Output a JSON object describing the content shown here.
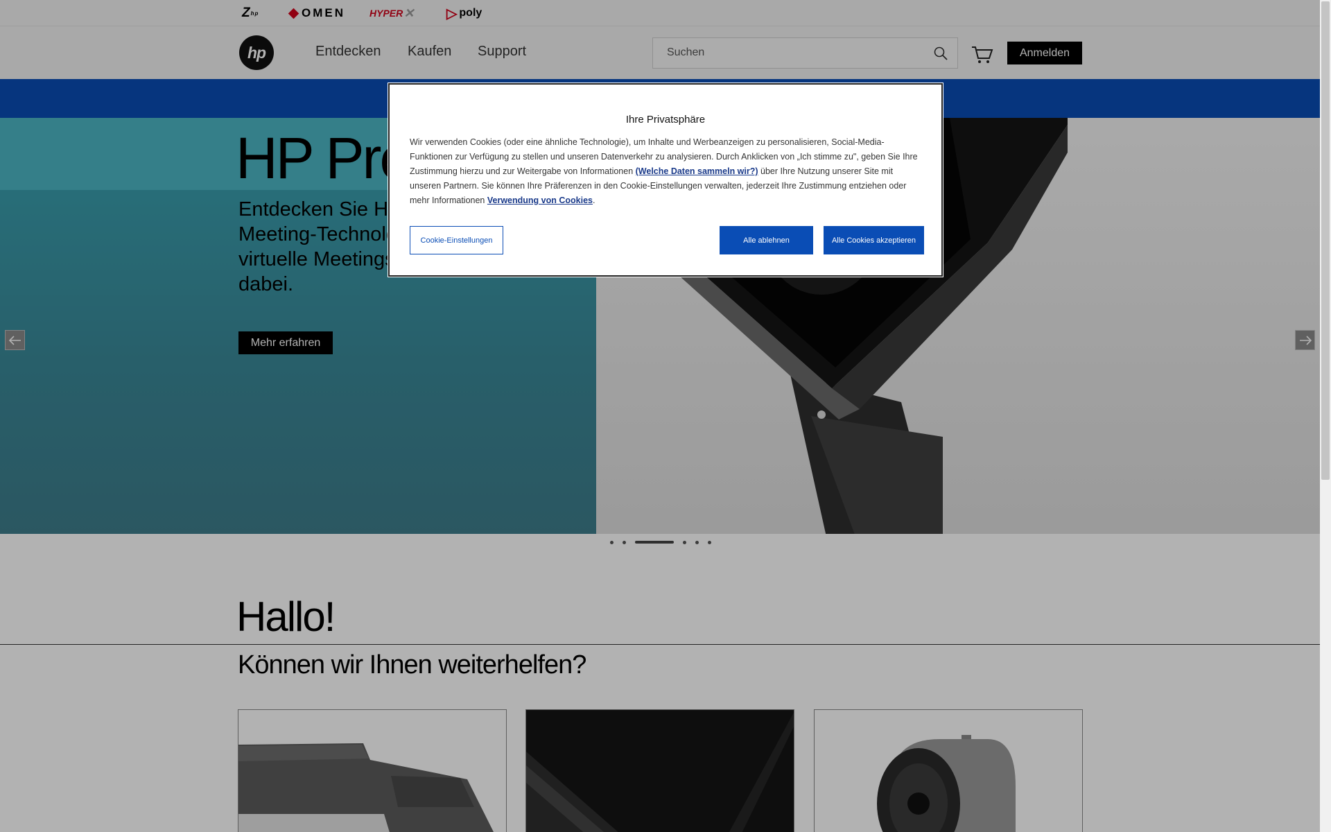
{
  "brands": {
    "z": "Z",
    "omen": "OMEN",
    "hyperx": "HYPER",
    "poly": "poly"
  },
  "header": {
    "logo_text": "hp",
    "nav": [
      "Entdecken",
      "Kaufen",
      "Support"
    ],
    "search_placeholder": "Suchen",
    "login_label": "Anmelden"
  },
  "hero": {
    "title": "HP Presence",
    "description": "Entdecken Sie HP Presence Meeting-Technologien. Damit werden virtuelle Meetings, als wäre man live dabei.",
    "cta_label": "Mehr erfahren",
    "slide_count": 6,
    "active_slide": 3
  },
  "greeting": {
    "hello": "Hallo!",
    "help_title": "Können wir Ihnen weiterhelfen?"
  },
  "cookie_modal": {
    "title": "Ihre Privatsphäre",
    "text_1": "Wir verwenden Cookies (oder eine ähnliche Technologie), um Inhalte und Werbeanzeigen zu personalisieren, Social-Media-Funktionen zur Verfügung zu stellen und unseren Datenverkehr zu analysieren. Durch Anklicken von „Ich stimme zu\", geben Sie Ihre Zustimmung hierzu und zur Weitergabe von Informationen ",
    "link_1": "(Welche Daten sammeln wir?)",
    "text_2": " über Ihre Nutzung unserer Site mit unseren Partnern. Sie können Ihre Präferenzen in den Cookie-Einstellungen verwalten, jederzeit Ihre Zustimmung entziehen oder mehr Informationen ",
    "link_2": "Verwendung von Cookies",
    "text_3": ".",
    "settings_label": "Cookie-Einstellungen",
    "reject_label": "Alle ablehnen",
    "accept_label": "Alle Cookies akzeptieren"
  },
  "colors": {
    "brand_blue": "#0a4db5",
    "hero_teal": "#3a8898",
    "omen_red": "#d0021b"
  }
}
